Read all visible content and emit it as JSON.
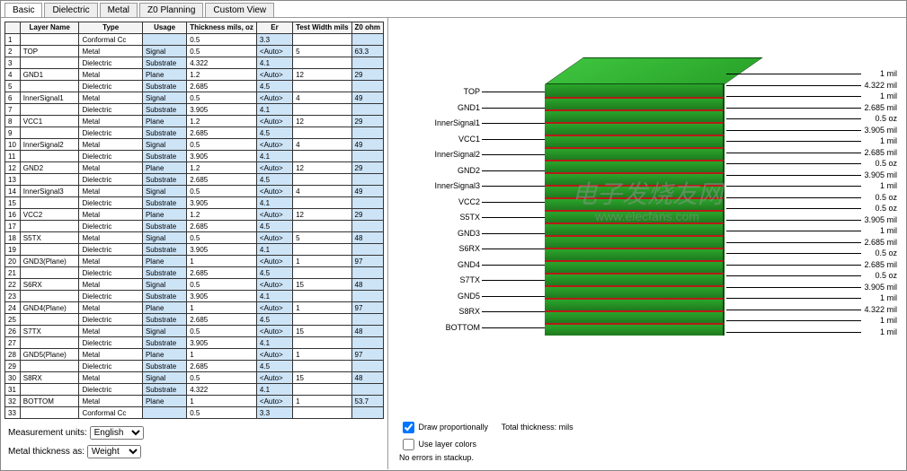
{
  "tabs": [
    "Basic",
    "Dielectric",
    "Metal",
    "Z0 Planning",
    "Custom View"
  ],
  "headers": {
    "n": "",
    "name": "Layer Name",
    "type": "Type",
    "usage": "Usage",
    "th": "Thickness mils, oz",
    "er": "Er",
    "tw": "Test Width mils",
    "z0": "Z0 ohm"
  },
  "rows": [
    {
      "n": "1",
      "name": "",
      "type": "Conformal Cc",
      "usage": "",
      "th": "0.5",
      "er": "3.3",
      "tw": "",
      "z0": ""
    },
    {
      "n": "2",
      "name": "TOP",
      "type": "Metal",
      "usage": "Signal",
      "th": "0.5",
      "er": "<Auto>",
      "tw": "5",
      "z0": "63.3"
    },
    {
      "n": "3",
      "name": "",
      "type": "Dielectric",
      "usage": "Substrate",
      "th": "4.322",
      "er": "4.1",
      "tw": "",
      "z0": ""
    },
    {
      "n": "4",
      "name": "GND1",
      "type": "Metal",
      "usage": "Plane",
      "th": "1.2",
      "er": "<Auto>",
      "tw": "12",
      "z0": "29"
    },
    {
      "n": "5",
      "name": "",
      "type": "Dielectric",
      "usage": "Substrate",
      "th": "2.685",
      "er": "4.5",
      "tw": "",
      "z0": ""
    },
    {
      "n": "6",
      "name": "InnerSignal1",
      "type": "Metal",
      "usage": "Signal",
      "th": "0.5",
      "er": "<Auto>",
      "tw": "4",
      "z0": "49"
    },
    {
      "n": "7",
      "name": "",
      "type": "Dielectric",
      "usage": "Substrate",
      "th": "3.905",
      "er": "4.1",
      "tw": "",
      "z0": ""
    },
    {
      "n": "8",
      "name": "VCC1",
      "type": "Metal",
      "usage": "Plane",
      "th": "1.2",
      "er": "<Auto>",
      "tw": "12",
      "z0": "29"
    },
    {
      "n": "9",
      "name": "",
      "type": "Dielectric",
      "usage": "Substrate",
      "th": "2.685",
      "er": "4.5",
      "tw": "",
      "z0": ""
    },
    {
      "n": "10",
      "name": "InnerSignal2",
      "type": "Metal",
      "usage": "Signal",
      "th": "0.5",
      "er": "<Auto>",
      "tw": "4",
      "z0": "49"
    },
    {
      "n": "11",
      "name": "",
      "type": "Dielectric",
      "usage": "Substrate",
      "th": "3.905",
      "er": "4.1",
      "tw": "",
      "z0": ""
    },
    {
      "n": "12",
      "name": "GND2",
      "type": "Metal",
      "usage": "Plane",
      "th": "1.2",
      "er": "<Auto>",
      "tw": "12",
      "z0": "29"
    },
    {
      "n": "13",
      "name": "",
      "type": "Dielectric",
      "usage": "Substrate",
      "th": "2.685",
      "er": "4.5",
      "tw": "",
      "z0": ""
    },
    {
      "n": "14",
      "name": "InnerSignal3",
      "type": "Metal",
      "usage": "Signal",
      "th": "0.5",
      "er": "<Auto>",
      "tw": "4",
      "z0": "49"
    },
    {
      "n": "15",
      "name": "",
      "type": "Dielectric",
      "usage": "Substrate",
      "th": "3.905",
      "er": "4.1",
      "tw": "",
      "z0": ""
    },
    {
      "n": "16",
      "name": "VCC2",
      "type": "Metal",
      "usage": "Plane",
      "th": "1.2",
      "er": "<Auto>",
      "tw": "12",
      "z0": "29"
    },
    {
      "n": "17",
      "name": "",
      "type": "Dielectric",
      "usage": "Substrate",
      "th": "2.685",
      "er": "4.5",
      "tw": "",
      "z0": ""
    },
    {
      "n": "18",
      "name": "S5TX",
      "type": "Metal",
      "usage": "Signal",
      "th": "0.5",
      "er": "<Auto>",
      "tw": "5",
      "z0": "48"
    },
    {
      "n": "19",
      "name": "",
      "type": "Dielectric",
      "usage": "Substrate",
      "th": "3.905",
      "er": "4.1",
      "tw": "",
      "z0": ""
    },
    {
      "n": "20",
      "name": "GND3(Plane)",
      "type": "Metal",
      "usage": "Plane",
      "th": "1",
      "er": "<Auto>",
      "tw": "1",
      "z0": "97"
    },
    {
      "n": "21",
      "name": "",
      "type": "Dielectric",
      "usage": "Substrate",
      "th": "2.685",
      "er": "4.5",
      "tw": "",
      "z0": ""
    },
    {
      "n": "22",
      "name": "S6RX",
      "type": "Metal",
      "usage": "Signal",
      "th": "0.5",
      "er": "<Auto>",
      "tw": "15",
      "z0": "48"
    },
    {
      "n": "23",
      "name": "",
      "type": "Dielectric",
      "usage": "Substrate",
      "th": "3.905",
      "er": "4.1",
      "tw": "",
      "z0": ""
    },
    {
      "n": "24",
      "name": "GND4(Plane)",
      "type": "Metal",
      "usage": "Plane",
      "th": "1",
      "er": "<Auto>",
      "tw": "1",
      "z0": "97"
    },
    {
      "n": "25",
      "name": "",
      "type": "Dielectric",
      "usage": "Substrate",
      "th": "2.685",
      "er": "4.5",
      "tw": "",
      "z0": ""
    },
    {
      "n": "26",
      "name": "S7TX",
      "type": "Metal",
      "usage": "Signal",
      "th": "0.5",
      "er": "<Auto>",
      "tw": "15",
      "z0": "48"
    },
    {
      "n": "27",
      "name": "",
      "type": "Dielectric",
      "usage": "Substrate",
      "th": "3.905",
      "er": "4.1",
      "tw": "",
      "z0": ""
    },
    {
      "n": "28",
      "name": "GND5(Plane)",
      "type": "Metal",
      "usage": "Plane",
      "th": "1",
      "er": "<Auto>",
      "tw": "1",
      "z0": "97"
    },
    {
      "n": "29",
      "name": "",
      "type": "Dielectric",
      "usage": "Substrate",
      "th": "2.685",
      "er": "4.5",
      "tw": "",
      "z0": ""
    },
    {
      "n": "30",
      "name": "S8RX",
      "type": "Metal",
      "usage": "Signal",
      "th": "0.5",
      "er": "<Auto>",
      "tw": "15",
      "z0": "48"
    },
    {
      "n": "31",
      "name": "",
      "type": "Dielectric",
      "usage": "Substrate",
      "th": "4.322",
      "er": "4.1",
      "tw": "",
      "z0": ""
    },
    {
      "n": "32",
      "name": "BOTTOM",
      "type": "Metal",
      "usage": "Plane",
      "th": "1",
      "er": "<Auto>",
      "tw": "1",
      "z0": "53.7"
    },
    {
      "n": "33",
      "name": "",
      "type": "Conformal Cc",
      "usage": "",
      "th": "0.5",
      "er": "3.3",
      "tw": "",
      "z0": ""
    }
  ],
  "controls": {
    "measLabel": "Measurement units:",
    "measVal": "English",
    "metalLabel": "Metal thickness as:",
    "metalVal": "Weight"
  },
  "viz": {
    "leftLabels": [
      "TOP",
      "GND1",
      "InnerSignal1",
      "VCC1",
      "InnerSignal2",
      "GND2",
      "InnerSignal3",
      "VCC2",
      "S5TX",
      "GND3",
      "S6RX",
      "GND4",
      "S7TX",
      "GND5",
      "S8RX",
      "BOTTOM"
    ],
    "rightLabels": [
      "1 mil",
      "4.322 mil",
      "1 mil",
      "2.685 mil",
      "0.5 oz",
      "3.905 mil",
      "1 mil",
      "2.685 mil",
      "0.5 oz",
      "3.905 mil",
      "1 mil",
      "0.5 oz",
      "0.5 oz",
      "3.905 mil",
      "1 mil",
      "2.685 mil",
      "0.5 oz",
      "2.685 mil",
      "0.5 oz",
      "3.905 mil",
      "1 mil",
      "4.322 mil",
      "1 mil",
      "1 mil"
    ],
    "drawProp": "Draw proportionally",
    "drawPropChk": true,
    "useColor": "Use layer colors",
    "useColorChk": false,
    "totalTh": "Total thickness:",
    "totalVal": "mils",
    "noErr": "No errors in stackup."
  },
  "watermark": {
    "big": "电子发烧友网",
    "small": "www.elecfans.com"
  }
}
